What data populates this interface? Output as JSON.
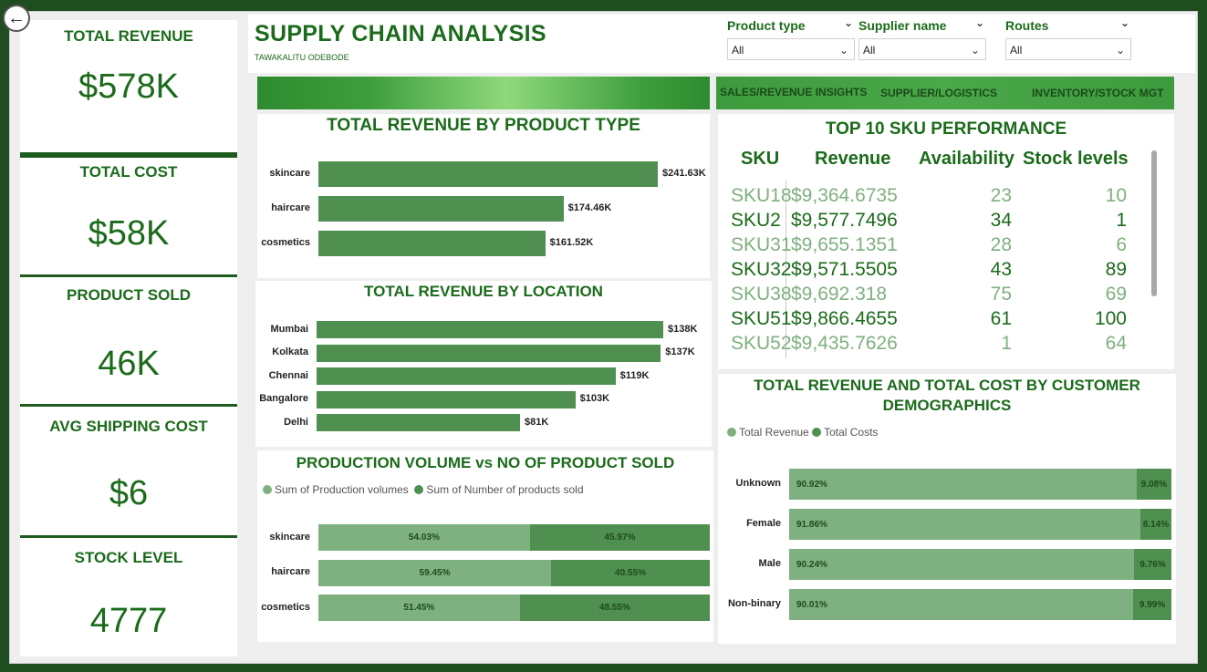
{
  "kpis": [
    {
      "label": "TOTAL REVENUE",
      "value": "$578K"
    },
    {
      "label": "TOTAL COST",
      "value": "$58K"
    },
    {
      "label": "PRODUCT SOLD",
      "value": "46K"
    },
    {
      "label": "AVG SHIPPING COST",
      "value": "$6"
    },
    {
      "label": "STOCK LEVEL",
      "value": "4777"
    }
  ],
  "header": {
    "title": "SUPPLY CHAIN ANALYSIS",
    "subtitle": "TAWAKALITU ODEBODE"
  },
  "filters": [
    {
      "label": "Product type",
      "value": "All"
    },
    {
      "label": "Supplier name",
      "value": "All"
    },
    {
      "label": "Routes",
      "value": "All"
    }
  ],
  "nav": [
    "SALES/REVENUE INSIGHTS",
    "SUPPLIER/LOGISTICS",
    "INVENTORY/STOCK MGT"
  ],
  "icons": {
    "back": "back-arrow-icon",
    "chevron": "chevron-down-icon"
  },
  "colors": {
    "primary": "#1b6b1b",
    "bar": "#4f8f4f",
    "light": "#7fb07f",
    "dark": "#4f8f4f"
  },
  "chart_data": [
    {
      "type": "bar",
      "title": "TOTAL REVENUE BY PRODUCT TYPE",
      "categories": [
        "skincare",
        "haircare",
        "cosmetics"
      ],
      "values": [
        241.63,
        174.46,
        161.52
      ],
      "labels": [
        "$241.63K",
        "$174.46K",
        "$161.52K"
      ]
    },
    {
      "type": "bar",
      "title": "TOTAL REVENUE BY LOCATION",
      "categories": [
        "Mumbai",
        "Kolkata",
        "Chennai",
        "Bangalore",
        "Delhi"
      ],
      "values": [
        138,
        137,
        119,
        103,
        81
      ],
      "labels": [
        "$138K",
        "$137K",
        "$119K",
        "$103K",
        "$81K"
      ]
    },
    {
      "type": "bar",
      "title": "PRODUCTION VOLUME vs NO OF PRODUCT SOLD",
      "stacked": "100%",
      "categories": [
        "skincare",
        "haircare",
        "cosmetics"
      ],
      "series": [
        {
          "name": "Sum of Production volumes",
          "values": [
            54.03,
            59.45,
            51.45
          ],
          "labels": [
            "54.03%",
            "59.45%",
            "51.45%"
          ]
        },
        {
          "name": "Sum of Number of products sold",
          "values": [
            45.97,
            40.55,
            48.55
          ],
          "labels": [
            "45.97%",
            "40.55%",
            "48.55%"
          ]
        }
      ]
    },
    {
      "type": "bar",
      "title": "TOTAL REVENUE AND TOTAL COST BY CUSTOMER DEMOGRAPHICS",
      "stacked": "100%",
      "categories": [
        "Unknown",
        "Female",
        "Male",
        "Non-binary"
      ],
      "series": [
        {
          "name": "Total Revenue",
          "values": [
            90.92,
            91.86,
            90.24,
            90.01
          ],
          "labels": [
            "90.92%",
            "91.86%",
            "90.24%",
            "90.01%"
          ]
        },
        {
          "name": "Total Costs",
          "values": [
            9.08,
            8.14,
            9.76,
            9.99
          ],
          "labels": [
            "9.08%",
            "8.14%",
            "9.76%",
            "9.99%"
          ]
        }
      ]
    },
    {
      "type": "table",
      "title": "TOP 10 SKU PERFORMANCE",
      "columns": [
        "SKU",
        "Revenue",
        "Availability",
        "Stock levels"
      ],
      "rows": [
        [
          "SKU18",
          "$9,364.6735",
          "23",
          "10"
        ],
        [
          "SKU2",
          "$9,577.7496",
          "34",
          "1"
        ],
        [
          "SKU31",
          "$9,655.1351",
          "28",
          "6"
        ],
        [
          "SKU32",
          "$9,571.5505",
          "43",
          "89"
        ],
        [
          "SKU38",
          "$9,692.318",
          "75",
          "69"
        ],
        [
          "SKU51",
          "$9,866.4655",
          "61",
          "100"
        ],
        [
          "SKU52",
          "$9,435.7626",
          "1",
          "64"
        ]
      ]
    }
  ]
}
